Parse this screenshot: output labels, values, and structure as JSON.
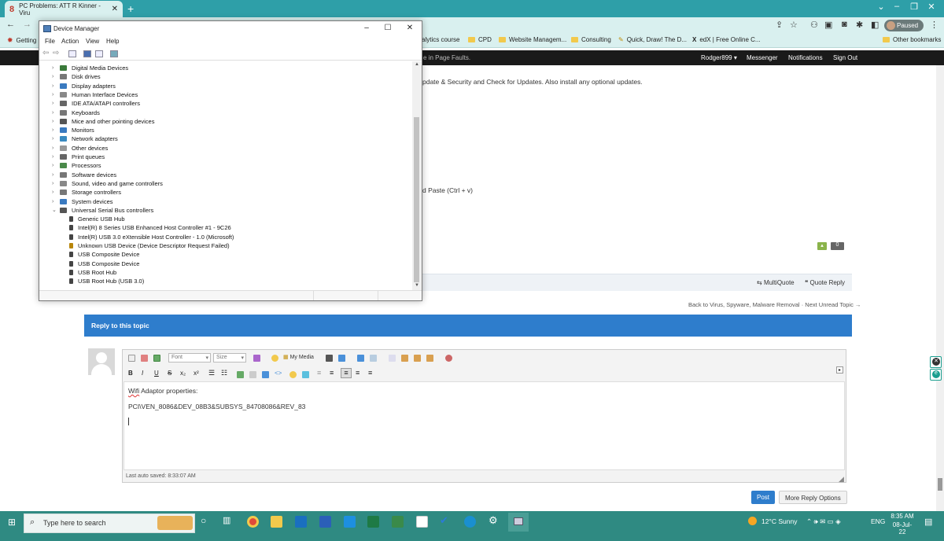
{
  "browser": {
    "tab_title": "PC Problems: ATT R Kinner - Viru",
    "profile_label": "Paused",
    "bookmarks": [
      "Getting",
      "alytics course",
      "CPD",
      "Website Managem...",
      "Consulting",
      "Quick, Draw! The D...",
      "edX | Free Online C...",
      "Other bookmarks"
    ]
  },
  "site_nav": {
    "partial_text": "e in Page Faults.",
    "user": "Rodger899",
    "messenger": "Messenger",
    "notifications": "Notifications",
    "signout": "Sign Out"
  },
  "post": {
    "line1": "pdate & Security and Check for Updates.  Also install any optional updates.",
    "line2": "d Paste (Ctrl + v)",
    "vote_count": "0",
    "multiquote": "MultiQuote",
    "quote_reply": "Quote Reply",
    "back_link": "Back to Virus, Spyware, Malware Removal",
    "sep": "·",
    "next_link": "Next Unread Topic →"
  },
  "reply": {
    "header": "Reply to this topic",
    "font_select": "Font",
    "size_select": "Size",
    "my_media": "My Media",
    "body_line1_word": "Wifi",
    "body_line1_rest": " Adaptor properties:",
    "body_line2": "PCI\\VEN_8086&DEV_08B3&SUBSYS_84708086&REV_83",
    "autosave": "Last auto saved: 8:33:07 AM",
    "post_button": "Post",
    "more_options": "More Reply Options"
  },
  "device_manager": {
    "title": "Device Manager",
    "menu": [
      "File",
      "Action",
      "View",
      "Help"
    ],
    "collapsed_items": [
      {
        "label": "Digital Media Devices",
        "color": "#3a7a3a"
      },
      {
        "label": "Disk drives",
        "color": "#777777"
      },
      {
        "label": "Display adapters",
        "color": "#3a7ac0"
      },
      {
        "label": "Human Interface Devices",
        "color": "#888888"
      },
      {
        "label": "IDE ATA/ATAPI controllers",
        "color": "#666666"
      },
      {
        "label": "Keyboards",
        "color": "#777777"
      },
      {
        "label": "Mice and other pointing devices",
        "color": "#555555"
      },
      {
        "label": "Monitors",
        "color": "#3a7ac0"
      },
      {
        "label": "Network adapters",
        "color": "#3a8ac0"
      },
      {
        "label": "Other devices",
        "color": "#999999"
      },
      {
        "label": "Print queues",
        "color": "#666666"
      },
      {
        "label": "Processors",
        "color": "#4a8a4a"
      },
      {
        "label": "Software devices",
        "color": "#777777"
      },
      {
        "label": "Sound, video and game controllers",
        "color": "#888888"
      },
      {
        "label": "Storage controllers",
        "color": "#777777"
      },
      {
        "label": "System devices",
        "color": "#3a7ac0"
      }
    ],
    "expanded_item": "Universal Serial Bus controllers",
    "usb_children": [
      "Generic USB Hub",
      "Intel(R) 8 Series USB Enhanced Host Controller #1 - 9C26",
      "Intel(R) USB 3.0 eXtensible Host Controller - 1.0 (Microsoft)",
      "Unknown USB Device (Device Descriptor Request Failed)",
      "USB Composite Device",
      "USB Composite Device",
      "USB Root Hub",
      "USB Root Hub (USB 3.0)"
    ]
  },
  "taskbar": {
    "search_placeholder": "Type here to search",
    "weather": "12°C  Sunny",
    "lang": "ENG",
    "time": "8:35 AM",
    "date": "08-Jul-22"
  },
  "colors": {
    "teal": "#2e9fa8",
    "blue_header": "#2e7dcc",
    "taskbar": "#2f8a82"
  }
}
